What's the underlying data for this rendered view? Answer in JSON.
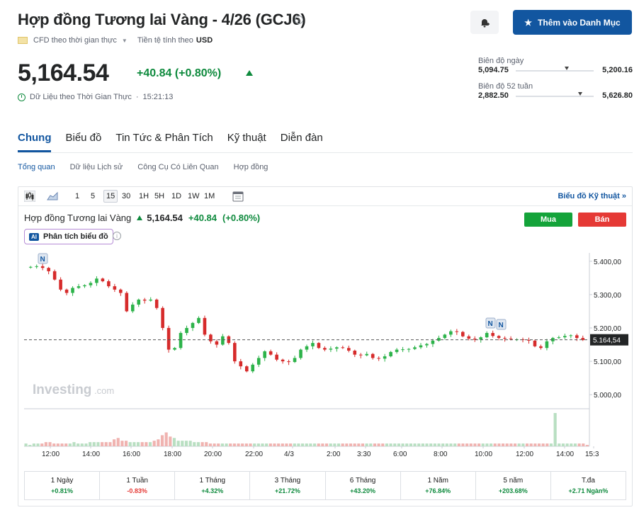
{
  "header": {
    "title": "Hợp đồng Tương lai Vàng - 4/26 (GCJ6)",
    "cfd_label": "CFD theo thời gian thực",
    "currency_label": "Tiền tệ tính theo",
    "currency": "USD",
    "watchlist_label": "Thêm vào Danh Mục"
  },
  "quote": {
    "price": "5,164.54",
    "change": "+40.84",
    "change_pct": "(+0.80%)",
    "realtime_label": "Dữ Liệu theo Thời Gian Thực",
    "time": "15:21:13"
  },
  "ranges": {
    "day": {
      "label": "Biên độ ngày",
      "low": "5,094.75",
      "high": "5,200.16",
      "position": 0.65
    },
    "week52": {
      "label": "Biên độ 52 tuần",
      "low": "2,882.50",
      "high": "5,626.80",
      "position": 0.83
    }
  },
  "tabs": [
    "Chung",
    "Biểu đồ",
    "Tin Tức & Phân Tích",
    "Kỹ thuật",
    "Diễn đàn"
  ],
  "subtabs": [
    "Tổng quan",
    "Dữ liệu Lịch sử",
    "Công Cụ Có Liên Quan",
    "Hợp đồng"
  ],
  "chart_toolbar": {
    "timeframes": [
      "1",
      "5",
      "15",
      "30",
      "1H",
      "5H",
      "1D",
      "1W",
      "1M"
    ],
    "selected": "15",
    "tech_link": "Biểu đồ Kỹ thuật »"
  },
  "chart_header": {
    "name": "Hợp đồng Tương lai Vàng",
    "price": "5,164.54",
    "change": "+40.84",
    "change_pct": "(+0.80%)",
    "ai_badge": "AI",
    "ai_label": "Phân tích biểu đồ",
    "buy": "Mua",
    "sell": "Bán",
    "watermark": "Investing",
    "watermark_suffix": ".com",
    "news_marker": "N"
  },
  "chart_data": {
    "type": "candlestick",
    "ylim": [
      4960,
      5425
    ],
    "y_ticks": [
      "5.400,00",
      "5.300,00",
      "5.200,00",
      "5.100,00",
      "5.000,00"
    ],
    "y_tick_values": [
      5400,
      5300,
      5200,
      5100,
      5000
    ],
    "x_ticks": [
      "12:00",
      "14:00",
      "16:00",
      "18:00",
      "20:00",
      "22:00",
      "4/3",
      "2:00",
      "3:30",
      "6:00",
      "8:00",
      "10:00",
      "12:00",
      "14:00",
      "15:3"
    ],
    "last_price_label": "5.164,54",
    "last_price_value": 5164.54,
    "closes": [
      5383,
      5385,
      5380,
      5370,
      5345,
      5315,
      5305,
      5320,
      5325,
      5328,
      5335,
      5348,
      5340,
      5325,
      5315,
      5305,
      5250,
      5270,
      5285,
      5282,
      5285,
      5260,
      5200,
      5135,
      5140,
      5185,
      5200,
      5215,
      5230,
      5180,
      5160,
      5150,
      5175,
      5155,
      5100,
      5085,
      5070,
      5090,
      5110,
      5130,
      5120,
      5105,
      5100,
      5098,
      5110,
      5135,
      5145,
      5155,
      5140,
      5135,
      5138,
      5142,
      5140,
      5132,
      5120,
      5118,
      5122,
      5110,
      5108,
      5115,
      5128,
      5135,
      5136,
      5137,
      5142,
      5148,
      5152,
      5162,
      5170,
      5180,
      5190,
      5188,
      5175,
      5168,
      5165,
      5172,
      5185,
      5176,
      5170,
      5168,
      5166,
      5166,
      5164,
      5162,
      5145,
      5140,
      5160,
      5170,
      5172,
      5176,
      5178,
      5170,
      5164
    ],
    "volumes": [
      2,
      1,
      2,
      2,
      2,
      3,
      3,
      2,
      2,
      2,
      2,
      2,
      3,
      2,
      2,
      2,
      3,
      3,
      3,
      3,
      3,
      3,
      5,
      6,
      4,
      4,
      3,
      3,
      3,
      3,
      3,
      3,
      4,
      5,
      8,
      10,
      7,
      6,
      4,
      4,
      4,
      4,
      3,
      3,
      3,
      3,
      2,
      2,
      2,
      2,
      2,
      2,
      2,
      2,
      2,
      2,
      2,
      2,
      2,
      2,
      2,
      2,
      2,
      2,
      2,
      2,
      2,
      2,
      2,
      2,
      2,
      2,
      2,
      2,
      2,
      2,
      2,
      2,
      2,
      2,
      2,
      2,
      2,
      2,
      2,
      2,
      2,
      2,
      2,
      2,
      2,
      2,
      2,
      2,
      2,
      2,
      2,
      2,
      2,
      2,
      2,
      2,
      2,
      2,
      2,
      2,
      2,
      2,
      2,
      2,
      2,
      2,
      2,
      2,
      2,
      2,
      2,
      2,
      2,
      2,
      2,
      2,
      2,
      2,
      2,
      2,
      2,
      2,
      2,
      2,
      2,
      2,
      24,
      2,
      2,
      2,
      2,
      2,
      2,
      2,
      1
    ]
  },
  "performance": [
    {
      "period": "1 Ngày",
      "value": "+0.81%",
      "dir": "pos"
    },
    {
      "period": "1 Tuần",
      "value": "-0.83%",
      "dir": "neg"
    },
    {
      "period": "1 Tháng",
      "value": "+4.32%",
      "dir": "pos"
    },
    {
      "period": "3 Tháng",
      "value": "+21.72%",
      "dir": "pos"
    },
    {
      "period": "6 Tháng",
      "value": "+43.20%",
      "dir": "pos"
    },
    {
      "period": "1 Năm",
      "value": "+76.84%",
      "dir": "pos"
    },
    {
      "period": "5 năm",
      "value": "+203.68%",
      "dir": "pos"
    },
    {
      "period": "T.đa",
      "value": "+2.71 Ngàn%",
      "dir": "pos"
    }
  ],
  "colors": {
    "accent": "#1256a0",
    "up": "#0e8a3d",
    "down": "#e53935",
    "candle_up": "#2db34a",
    "candle_down": "#d62b2b"
  }
}
